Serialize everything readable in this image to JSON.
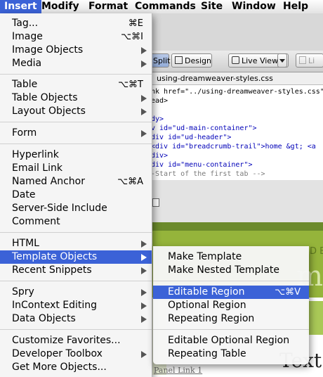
{
  "menubar": {
    "items": [
      "Insert",
      "Modify",
      "Format",
      "Commands",
      "Site",
      "Window",
      "Help"
    ],
    "active": "Insert"
  },
  "toolbar": {
    "split_label": "Split",
    "design_label": "Design",
    "live_view_label": "Live View",
    "live_code_label": "Li"
  },
  "document": {
    "file_path": "using-dreamweaver-styles.css",
    "code_lines": [
      "nk href=\"../using-dreamweaver-styles.css\"",
      "ead>",
      "",
      "dy>",
      "v id=\"ud-main-container\">",
      "div id=\"ud-header\">",
      "  <div id=\"breadcrumb-trail\">home &gt; <a",
      "div>",
      "div id=\"menu-container\">",
      "-Start of the first tab -->"
    ],
    "design_logo_letters": "D E",
    "design_big_text": "m",
    "panel_link": "Panel Link 1",
    "design_word": "Text"
  },
  "insert_menu": {
    "items": [
      {
        "label": "Tag...",
        "shortcut": "⌘E"
      },
      {
        "label": "Image",
        "shortcut": "⌥⌘I"
      },
      {
        "label": "Image Objects",
        "submenu": true
      },
      {
        "label": "Media",
        "submenu": true
      },
      {
        "label": "Table",
        "shortcut": "⌥⌘T"
      },
      {
        "label": "Table Objects",
        "submenu": true
      },
      {
        "label": "Layout Objects",
        "submenu": true
      },
      {
        "label": "Form",
        "submenu": true
      },
      {
        "label": "Hyperlink"
      },
      {
        "label": "Email Link"
      },
      {
        "label": "Named Anchor",
        "shortcut": "⌥⌘A"
      },
      {
        "label": "Date"
      },
      {
        "label": "Server-Side Include"
      },
      {
        "label": "Comment"
      },
      {
        "label": "HTML",
        "submenu": true
      },
      {
        "label": "Template Objects",
        "submenu": true,
        "highlighted": true
      },
      {
        "label": "Recent Snippets",
        "submenu": true
      },
      {
        "label": "Spry",
        "submenu": true
      },
      {
        "label": "InContext Editing",
        "submenu": true
      },
      {
        "label": "Data Objects",
        "submenu": true
      },
      {
        "label": "Customize Favorites..."
      },
      {
        "label": "Developer Toolbox",
        "submenu": true
      },
      {
        "label": "Get More Objects..."
      }
    ]
  },
  "template_submenu": {
    "items": [
      {
        "label": "Make Template"
      },
      {
        "label": "Make Nested Template"
      },
      {
        "label": "Editable Region",
        "shortcut": "⌥⌘V",
        "highlighted": true
      },
      {
        "label": "Optional Region"
      },
      {
        "label": "Repeating Region"
      },
      {
        "label": "Editable Optional Region"
      },
      {
        "label": "Repeating Table"
      }
    ]
  },
  "colors": {
    "highlight": "#3b62d7",
    "menu_bg": "#f6f6f6",
    "design_green": "#95b43b"
  }
}
